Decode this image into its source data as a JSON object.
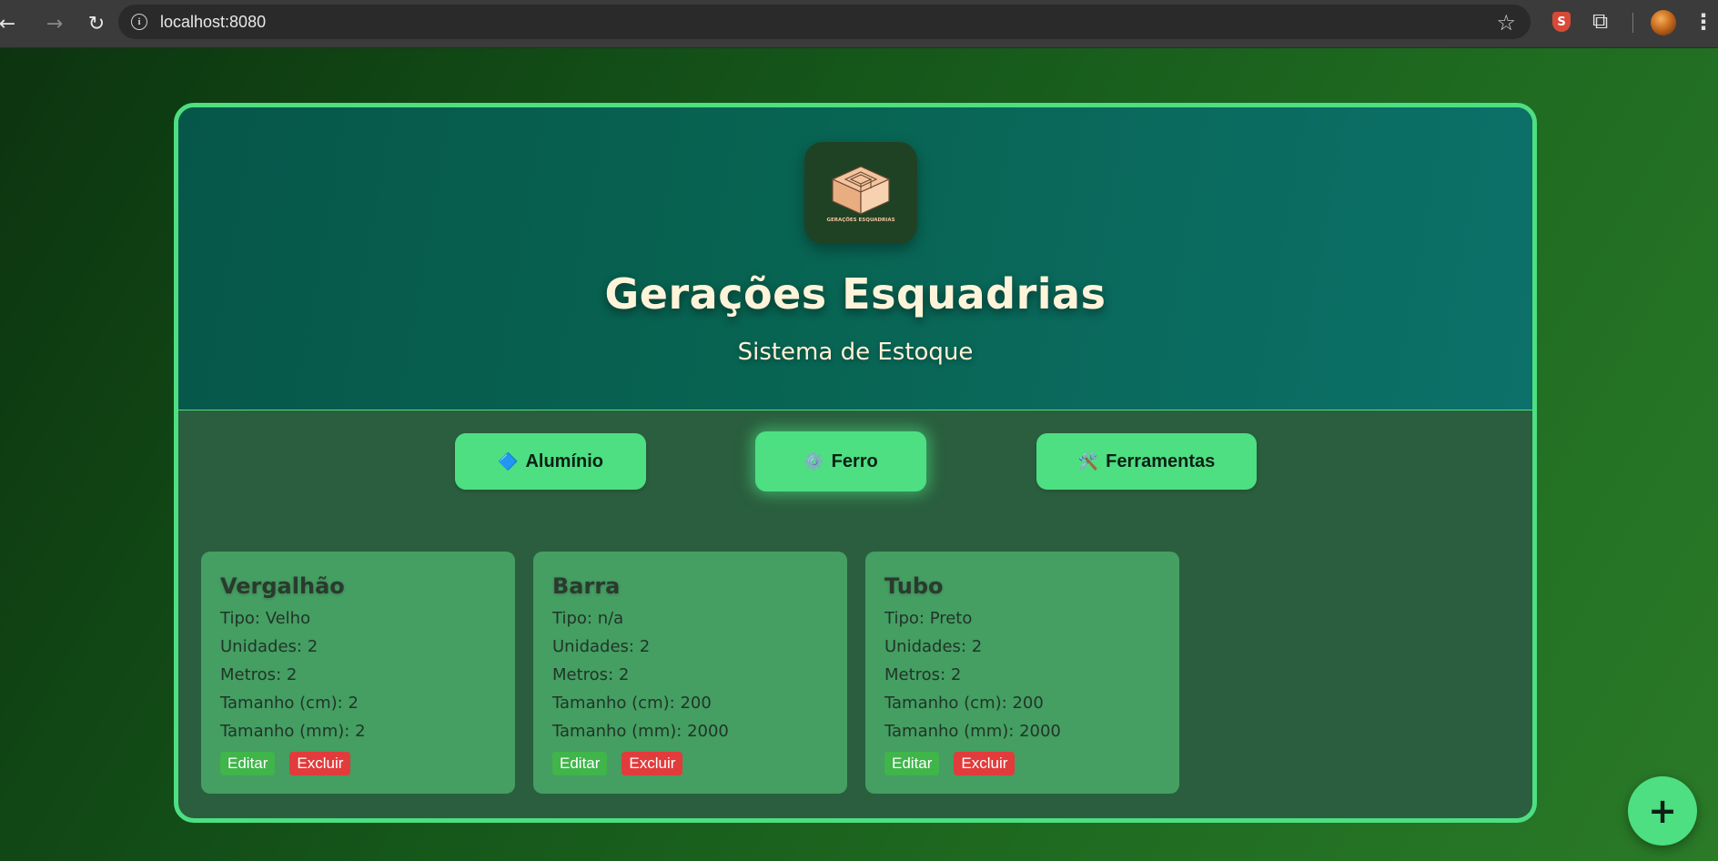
{
  "browser": {
    "url": "localhost:8080",
    "back_icon": "arrow-left-icon",
    "forward_icon": "arrow-right-icon",
    "reload_icon": "reload-icon",
    "bookmark_icon": "star-icon",
    "extensions": [
      "shield-extension-icon",
      "puzzle-extension-icon"
    ],
    "profile": "avatar"
  },
  "header": {
    "logo_text": "GERAÇÕES ESQUADRIAS",
    "title": "Gerações Esquadrias",
    "subtitle": "Sistema de Estoque"
  },
  "tabs": [
    {
      "label": "Alumínio",
      "icon": "🔷",
      "active": false
    },
    {
      "label": "Ferro",
      "icon": "⚙️",
      "active": true
    },
    {
      "label": "Ferramentas",
      "icon": "🛠️",
      "active": false
    }
  ],
  "field_labels": {
    "tipo": "Tipo",
    "unidades": "Unidades",
    "metros": "Metros",
    "tamanho_cm": "Tamanho (cm)",
    "tamanho_mm": "Tamanho (mm)"
  },
  "items": [
    {
      "name": "Vergalhão",
      "tipo": "Velho",
      "unidades": "2",
      "metros": "2",
      "tamanho_cm": "2",
      "tamanho_mm": "2"
    },
    {
      "name": "Barra",
      "tipo": "n/a",
      "unidades": "2",
      "metros": "2",
      "tamanho_cm": "200",
      "tamanho_mm": "2000"
    },
    {
      "name": "Tubo",
      "tipo": "Preto",
      "unidades": "2",
      "metros": "2",
      "tamanho_cm": "200",
      "tamanho_mm": "2000"
    }
  ],
  "actions": {
    "edit": "Editar",
    "delete": "Excluir"
  },
  "fab": {
    "label": "+"
  },
  "colors": {
    "accent": "#4ddf82",
    "card": "#459e62",
    "panel": "#2a5e3e",
    "edit": "#3fb54a",
    "delete": "#e23b3b",
    "title_text": "#fff4da"
  }
}
